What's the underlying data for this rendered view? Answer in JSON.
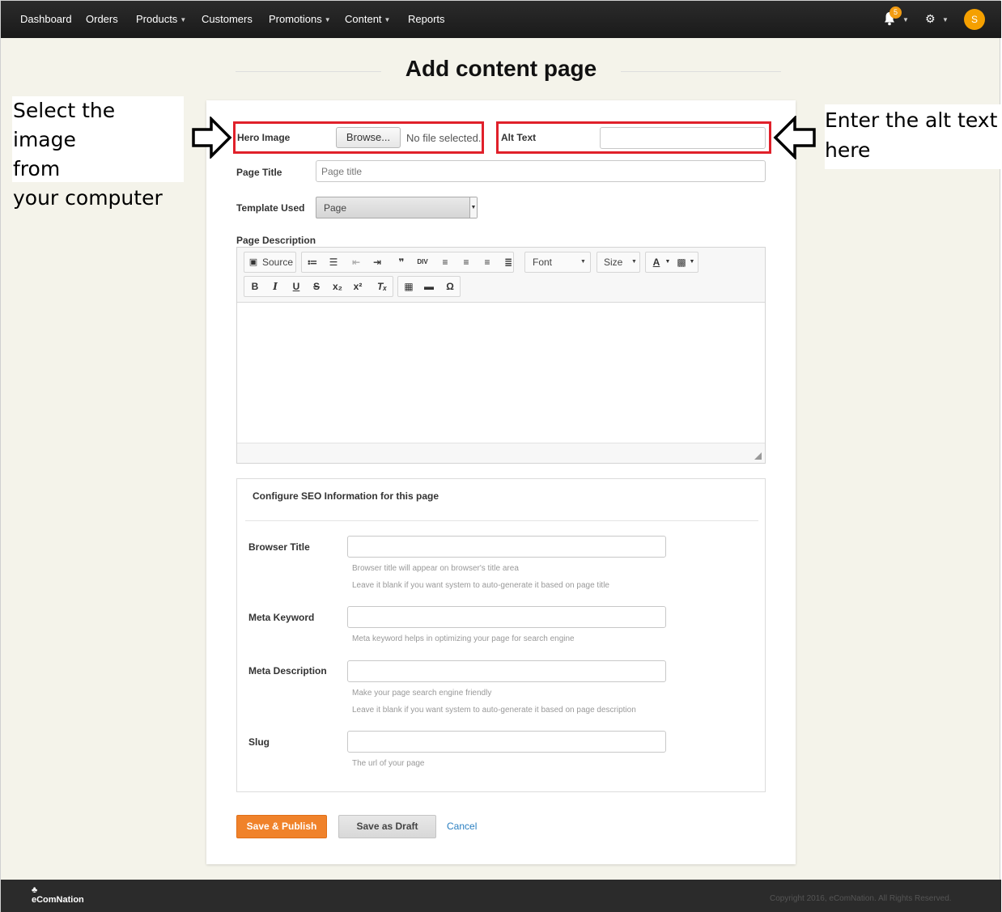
{
  "nav": {
    "items": [
      {
        "label": "Dashboard",
        "has_caret": false
      },
      {
        "label": "Orders",
        "has_caret": false
      },
      {
        "label": "Products",
        "has_caret": true
      },
      {
        "label": "Customers",
        "has_caret": false
      },
      {
        "label": "Promotions",
        "has_caret": true
      },
      {
        "label": "Content",
        "has_caret": true
      },
      {
        "label": "Reports",
        "has_caret": false
      }
    ],
    "notification_count": "5",
    "avatar_initial": "S",
    "icons": {
      "notifications": "bell-icon",
      "settings": "gear-icon"
    }
  },
  "page": {
    "title": "Add content page"
  },
  "annotations": {
    "left": [
      "Select the image",
      "from",
      "your computer"
    ],
    "right": [
      "Enter the alt text",
      "here"
    ],
    "highlight_color": "#e0202a"
  },
  "form": {
    "hero_image": {
      "label": "Hero Image",
      "browse_label": "Browse...",
      "status": "No file selected."
    },
    "alt_text": {
      "label": "Alt Text",
      "value": ""
    },
    "page_title": {
      "label": "Page Title",
      "placeholder": "Page title"
    },
    "template": {
      "label": "Template Used",
      "selected": "Page"
    },
    "description": {
      "label": "Page Description"
    }
  },
  "editor": {
    "source_label": "Source",
    "font_label": "Font",
    "size_label": "Size"
  },
  "seo": {
    "heading": "Configure SEO Information for this page",
    "browser_title": {
      "label": "Browser Title",
      "help1": "Browser title will appear on browser's title area",
      "help2": "Leave it blank if you want system to auto-generate it based on page title"
    },
    "meta_keyword": {
      "label": "Meta Keyword",
      "help1": "Meta keyword helps in optimizing your page for search engine"
    },
    "meta_description": {
      "label": "Meta Description",
      "help1": "Make your page search engine friendly",
      "help2": "Leave it blank if you want system to auto-generate it based on page description"
    },
    "slug": {
      "label": "Slug",
      "help1": "The url of your page"
    }
  },
  "actions": {
    "publish": "Save & Publish",
    "draft": "Save as Draft",
    "cancel": "Cancel"
  },
  "footer": {
    "brand": "eComNation",
    "copyright": "Copyright 2016, eComNation. All Rights Reserved."
  },
  "colors": {
    "accent": "#f0822a",
    "link": "#2a7fc1",
    "nav_bg": "#1f1f1f",
    "page_bg": "#f4f3ea"
  }
}
